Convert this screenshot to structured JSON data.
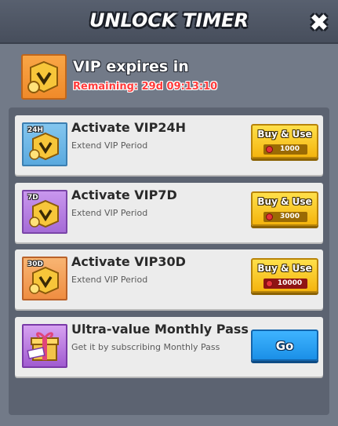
{
  "dialog": {
    "title": "UNLOCK TIMER",
    "close_icon": "close-icon"
  },
  "header": {
    "title": "VIP expires in",
    "remaining": "Remaining: 29d 09:13:10",
    "icon": "vip-badge-icon"
  },
  "items": [
    {
      "title": "Activate VIP24H",
      "subtitle": "Extend VIP Period",
      "tag": "24H",
      "button": "Buy & Use",
      "price": "1000",
      "icon": "vip24h-icon"
    },
    {
      "title": "Activate VIP7D",
      "subtitle": "Extend VIP Period",
      "tag": "7D",
      "button": "Buy & Use",
      "price": "3000",
      "icon": "vip7d-icon"
    },
    {
      "title": "Activate VIP30D",
      "subtitle": "Extend VIP Period",
      "tag": "30D",
      "button": "Buy & Use",
      "price": "10000",
      "icon": "vip30d-icon"
    },
    {
      "title": "Ultra-value Monthly Pass",
      "subtitle": "Get it by subscribing Monthly Pass",
      "button": "Go",
      "icon": "monthly-pass-gift-icon"
    }
  ],
  "colors": {
    "remaining_text": "#ff3b3b",
    "gold_button": "#f4b40e",
    "blue_button": "#1b8fe7"
  }
}
